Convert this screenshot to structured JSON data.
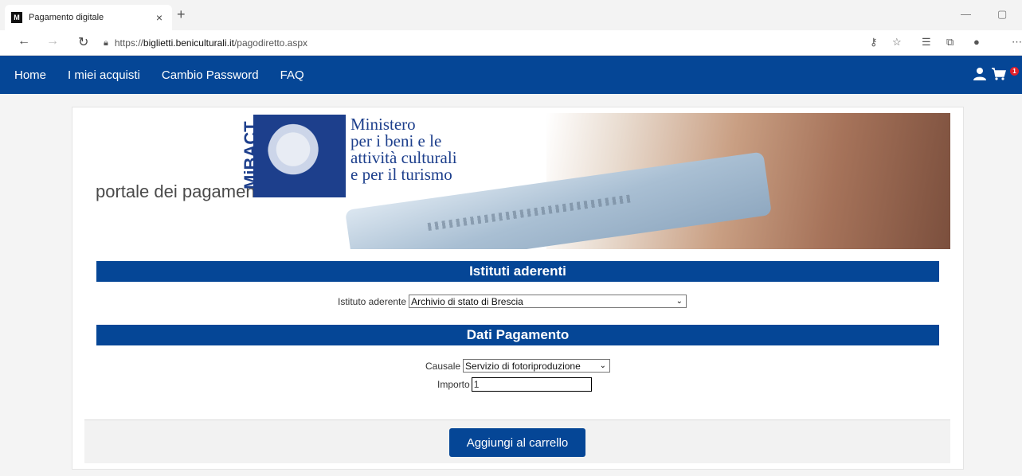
{
  "browser": {
    "tab_title": "Pagamento digitale",
    "tab_close": "×",
    "new_tab": "+",
    "favicon_text": "M",
    "url_prefix": "https://",
    "url_domain": "biglietti.beniculturali.it",
    "url_path": "/pagodiretto.aspx"
  },
  "nav": {
    "items": [
      "Home",
      "I miei acquisti",
      "Cambio Password",
      "FAQ"
    ],
    "cart_count": "1"
  },
  "banner": {
    "portal_text": "portale dei pagamenti",
    "logo_text": "MiBACT",
    "ministry_lines": [
      "Ministero",
      "per i beni e le",
      "attività culturali",
      "e per il turismo"
    ]
  },
  "sections": {
    "istituti_title": "Istituti aderenti",
    "pagamento_title": "Dati Pagamento"
  },
  "form": {
    "istituto_label": "Istituto aderente",
    "istituto_value": "Archivio di stato di Brescia",
    "causale_label": "Causale",
    "causale_value": "Servizio di fotoriproduzione",
    "importo_label": "Importo",
    "importo_value": "1",
    "submit_label": "Aggiungi al carrello"
  },
  "colors": {
    "brand_blue": "#054696",
    "logo_blue": "#1d3f8c",
    "badge_red": "#e0202a"
  }
}
